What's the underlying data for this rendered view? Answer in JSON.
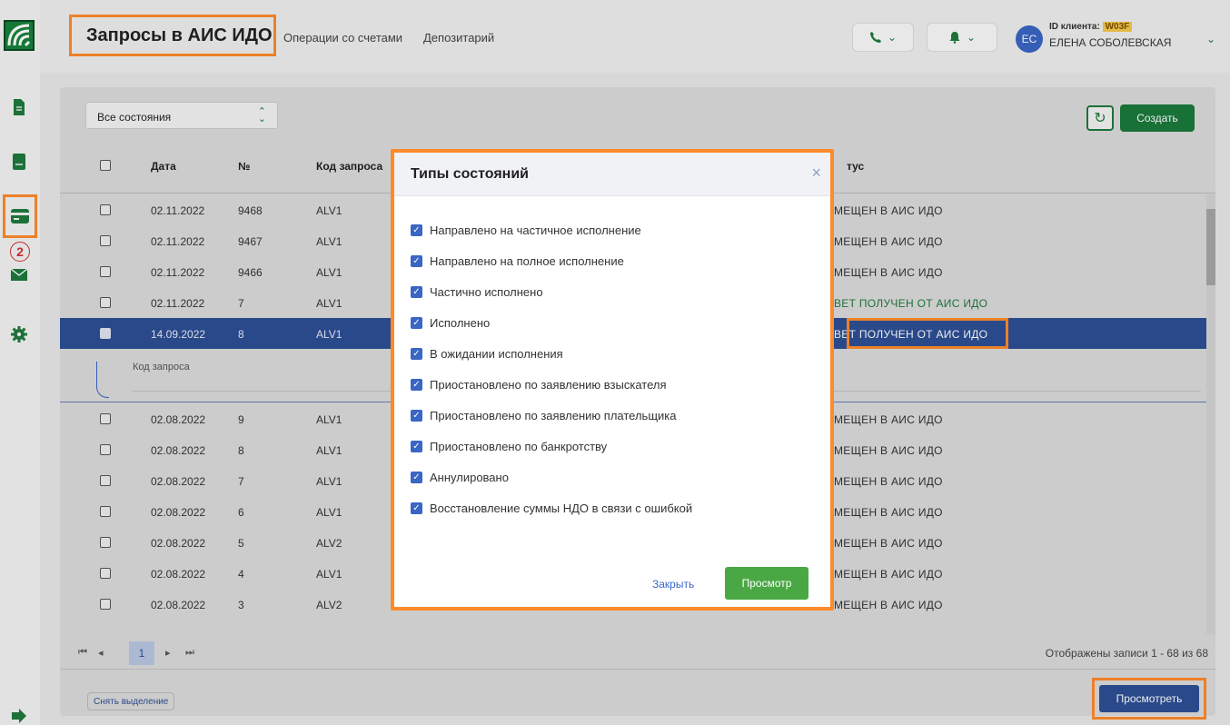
{
  "header": {
    "title": "Запросы в АИС ИДО",
    "nav": [
      "Операции со счетами",
      "Депозитарий"
    ],
    "client_id_label": "ID клиента:",
    "client_id": "W03F",
    "client_name": "ЕЛЕНА СОБОЛЕВСКАЯ",
    "avatar_initials": "ЕС"
  },
  "sidebar": {
    "badge_count": "2"
  },
  "toolbar": {
    "filter_value": "Все состояния",
    "create_label": "Создать"
  },
  "table": {
    "columns": [
      "Дата",
      "№",
      "Код запроса",
      "тус"
    ],
    "rows": [
      {
        "date": "02.11.2022",
        "num": "9468",
        "code": "ALV1",
        "status": "МЕЩЕН В АИС ИДО"
      },
      {
        "date": "02.11.2022",
        "num": "9467",
        "code": "ALV1",
        "status": "МЕЩЕН В АИС ИДО"
      },
      {
        "date": "02.11.2022",
        "num": "9466",
        "code": "ALV1",
        "status": "МЕЩЕН В АИС ИДО"
      },
      {
        "date": "02.11.2022",
        "num": "7",
        "code": "ALV1",
        "status": "ВЕТ ПОЛУЧЕН ОТ АИС ИДО"
      },
      {
        "date": "14.09.2022",
        "num": "8",
        "code": "ALV1",
        "status": "ВЕТ ПОЛУЧЕН ОТ АИС ИДО"
      },
      {
        "date": "02.08.2022",
        "num": "9",
        "code": "ALV1",
        "status": "МЕЩЕН В АИС ИДО"
      },
      {
        "date": "02.08.2022",
        "num": "8",
        "code": "ALV1",
        "status": "МЕЩЕН В АИС ИДО"
      },
      {
        "date": "02.08.2022",
        "num": "7",
        "code": "ALV1",
        "status": "МЕЩЕН В АИС ИДО"
      },
      {
        "date": "02.08.2022",
        "num": "6",
        "code": "ALV1",
        "status": "МЕЩЕН В АИС ИДО"
      },
      {
        "date": "02.08.2022",
        "num": "5",
        "code": "ALV2",
        "status": "МЕЩЕН В АИС ИДО"
      },
      {
        "date": "02.08.2022",
        "num": "4",
        "code": "ALV1",
        "status": "МЕЩЕН В АИС ИДО"
      },
      {
        "date": "02.08.2022",
        "num": "3",
        "code": "ALV2",
        "status": "МЕЩЕН В АИС ИДО"
      }
    ],
    "detail_label": "Код запроса"
  },
  "pager": {
    "current_page": "1",
    "records_info": "Отображены записи 1 - 68 из 68"
  },
  "footer": {
    "clear_label": "Снять выделение",
    "view_label": "Просмотреть"
  },
  "modal": {
    "title": "Типы состояний",
    "options": [
      "Направлено на частичное исполнение",
      "Направлено на полное исполнение",
      "Частично исполнено",
      "Исполнено",
      "В ожидании исполнения",
      "Приостановлено по заявлению взыскателя",
      "Приостановлено по заявлению плательщика",
      "Приостановлено по банкротству",
      "Аннулировано",
      "Восстановление суммы НДО в связи с ошибкой"
    ],
    "close_label": "Закрыть",
    "view_label": "Просмотр"
  }
}
